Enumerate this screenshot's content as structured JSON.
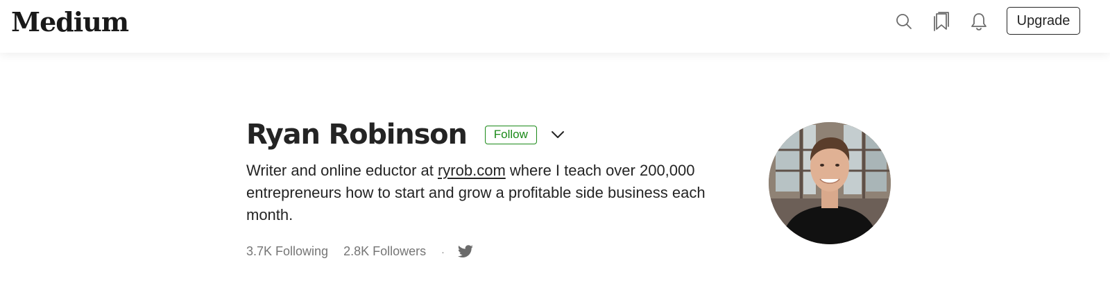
{
  "header": {
    "logo_text": "Medium",
    "icons": [
      "search-icon",
      "bookmarks-icon",
      "notifications-icon"
    ],
    "upgrade_label": "Upgrade"
  },
  "profile": {
    "name": "Ryan Robinson",
    "follow_label": "Follow",
    "bio_prefix": "Writer and online eductor at ",
    "bio_link": "ryrob.com",
    "bio_suffix": " where I teach over 200,000 entrepreneurs how to start and grow a profitable side business each month.",
    "following": "3.7K Following",
    "followers": "2.8K Followers",
    "separator": "·",
    "social_icon": "twitter-icon"
  },
  "colors": {
    "accent": "#1a8917",
    "text": "#242424",
    "muted": "#757575",
    "icon": "#6b6b6b"
  }
}
